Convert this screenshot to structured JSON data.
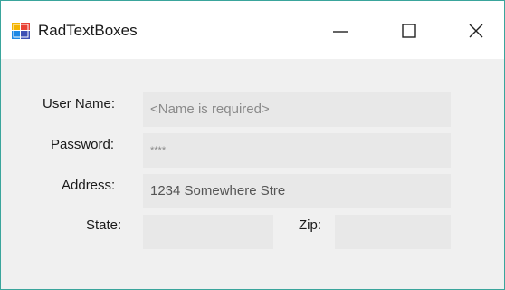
{
  "window": {
    "title": "RadTextBoxes",
    "controls": {
      "minimize": "minimize-icon",
      "maximize": "maximize-icon",
      "close": "close-icon"
    },
    "accent_border": "#3aa59c"
  },
  "form": {
    "user_name": {
      "label": "User Name:",
      "value": "",
      "placeholder": "<Name is required>"
    },
    "password": {
      "label": "Password:",
      "value": "****"
    },
    "address": {
      "label": "Address:",
      "value": "1234 Somewhere Stre"
    },
    "state": {
      "label": "State:",
      "value": ""
    },
    "zip": {
      "label": "Zip:",
      "value": ""
    }
  }
}
